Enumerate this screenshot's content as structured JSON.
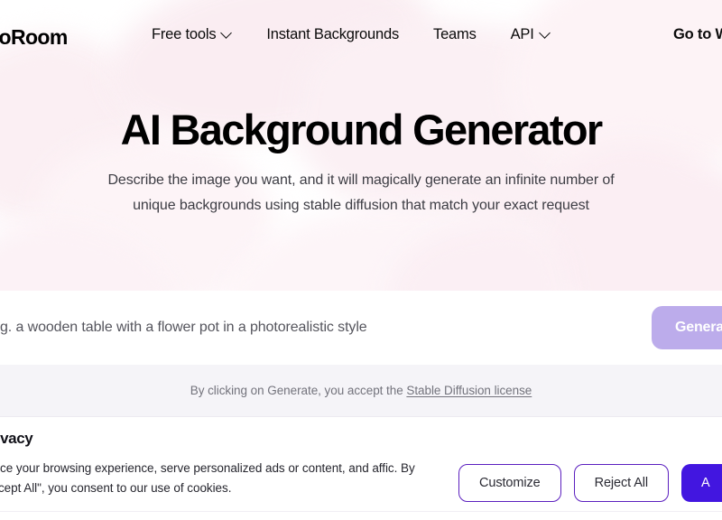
{
  "header": {
    "logo_text": "otoRoom",
    "nav_items": [
      {
        "label": "Free tools",
        "has_chevron": true,
        "icon": "chevron-down-icon"
      },
      {
        "label": "Instant Backgrounds",
        "has_chevron": false
      },
      {
        "label": "Teams",
        "has_chevron": false
      },
      {
        "label": "API",
        "has_chevron": true,
        "icon": "chevron-down-icon"
      }
    ],
    "cta_label": "Go to W"
  },
  "hero": {
    "title": "AI Background Generator",
    "subtitle": "Describe the image you want, and it will magically generate an infinite number of unique backgrounds using stable diffusion that match your exact request"
  },
  "prompt": {
    "placeholder": "g. a wooden table with a flower pot in a photorealistic style",
    "value": "",
    "generate_label": "Generate",
    "generate_color": "#bcaceb"
  },
  "license": {
    "prefix": "By clicking on Generate, you accept the ",
    "link_label": "Stable Diffusion license"
  },
  "cookie_banner": {
    "title": "your privacy",
    "body": "es to enhance your browsing experience, serve personalized ads or content, and affic. By clicking \"Accept All\", you consent to our use of cookies.",
    "customize_label": "Customize",
    "reject_label": "Reject All",
    "accept_label": "A",
    "outline_color": "#5b1fbf",
    "accept_color": "#4216e0"
  }
}
